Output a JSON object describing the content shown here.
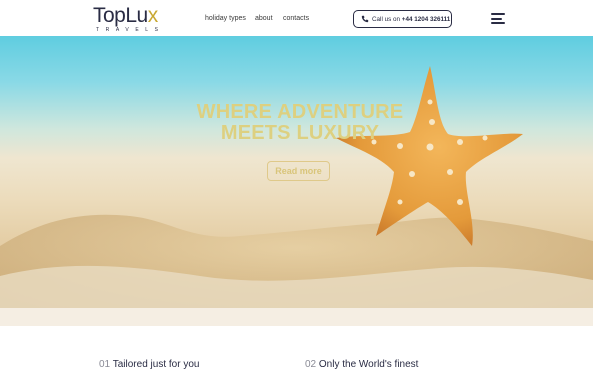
{
  "header": {
    "logo": {
      "main": "TopLux",
      "sub": "TRAVELS"
    },
    "nav": [
      "holiday types",
      "about",
      "contacts"
    ],
    "call": {
      "prefix": "Call us on ",
      "number": "+44 1204 326111"
    }
  },
  "hero": {
    "title_line1": "WHERE ADVENTURE",
    "title_line2": "MEETS LUXURY",
    "button": "Read more"
  },
  "features": [
    {
      "num": "01",
      "label": "Tailored just for you"
    },
    {
      "num": "02",
      "label": "Only the World's finest"
    }
  ],
  "colors": {
    "brand_dark": "#2a2c44",
    "brand_gold": "#c8a833",
    "hero_text": "#ddd080"
  },
  "icons": {
    "call": "phone-icon",
    "menu": "hamburger-menu-icon"
  }
}
